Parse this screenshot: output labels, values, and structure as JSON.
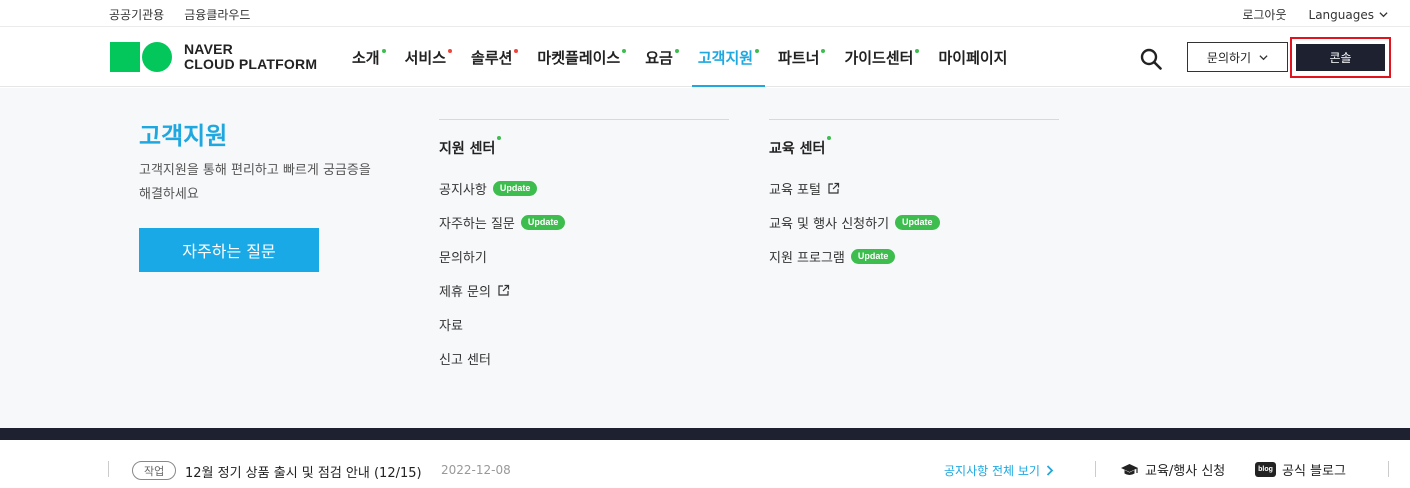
{
  "topbar": {
    "links": [
      "공공기관용",
      "금융클라우드"
    ],
    "logout": "로그아웃",
    "languages": "Languages"
  },
  "logo": {
    "line1": "NAVER",
    "line2": "CLOUD PLATFORM",
    "brand_color": "#03c75a"
  },
  "nav": {
    "items": [
      {
        "label": "소개",
        "dot": "#3dbd4d"
      },
      {
        "label": "서비스",
        "dot": "#f04438"
      },
      {
        "label": "솔루션",
        "dot": "#f04438"
      },
      {
        "label": "마켓플레이스",
        "dot": "#3dbd4d"
      },
      {
        "label": "요금",
        "dot": "#3dbd4d"
      },
      {
        "label": "고객지원",
        "dot": "#3dbd4d",
        "active": true
      },
      {
        "label": "파트너",
        "dot": "#3dbd4d"
      },
      {
        "label": "가이드센터",
        "dot": "#3dbd4d"
      },
      {
        "label": "마이페이지",
        "dot": ""
      }
    ],
    "accent": "#1fa8e0"
  },
  "header": {
    "inquiry_label": "문의하기",
    "console_label": "콘솔"
  },
  "panel": {
    "title": "고객지원",
    "desc": "고객지원을 통해 편리하고 빠르게 궁금증을 해결하세요",
    "faq_button": "자주하는 질문",
    "support_center": {
      "heading": "지원 센터",
      "items": [
        {
          "label": "공지사항",
          "badge": "Update"
        },
        {
          "label": "자주하는 질문",
          "badge": "Update"
        },
        {
          "label": "문의하기"
        },
        {
          "label": "제휴 문의",
          "external": true
        },
        {
          "label": "자료"
        },
        {
          "label": "신고 센터"
        }
      ]
    },
    "edu_center": {
      "heading": "교육 센터",
      "items": [
        {
          "label": "교육 포털",
          "external": true
        },
        {
          "label": "교육 및 행사 신청하기",
          "badge": "Update"
        },
        {
          "label": "지원 프로그램",
          "badge": "Update"
        }
      ]
    }
  },
  "notice": {
    "tag": "작업",
    "message": "12월 정기 상품 출시 및 점검 안내 (12/15)",
    "date": "2022-12-08",
    "view_all": "공지사항 전체 보기",
    "edu_link": "교육/행사 신청",
    "blog_icon": "blog",
    "blog_link": "공식 블로그"
  }
}
